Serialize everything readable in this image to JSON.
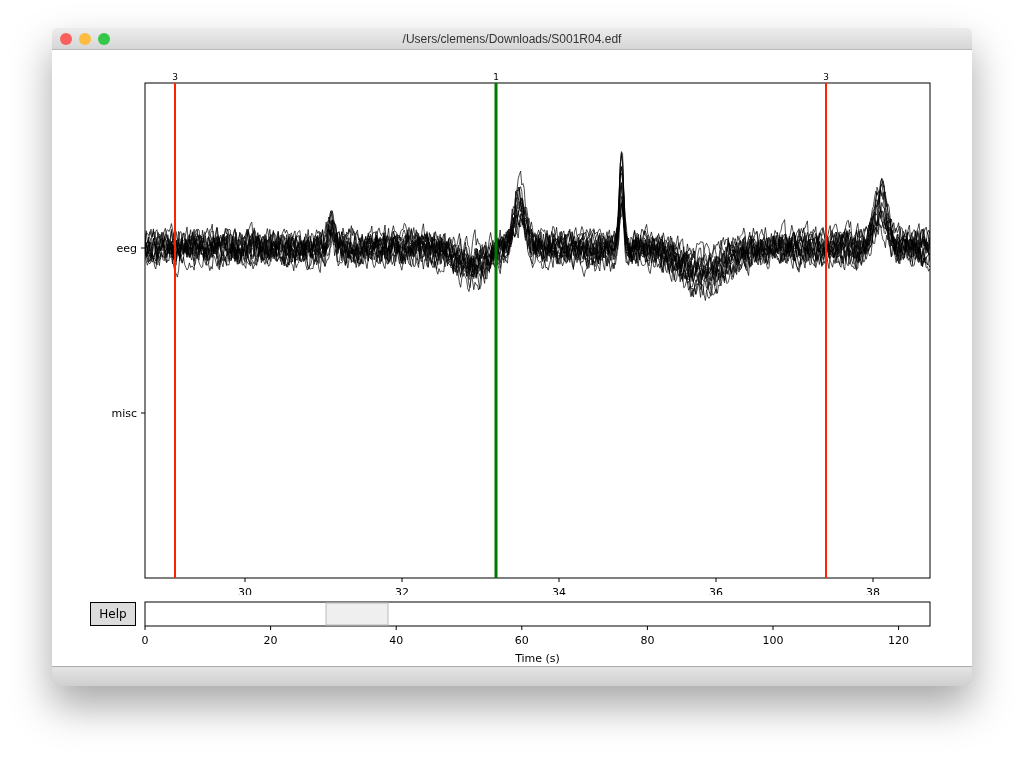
{
  "window": {
    "title": "/Users/clemens/Downloads/S001R04.edf"
  },
  "plot": {
    "channels": [
      "eeg",
      "misc"
    ],
    "x_tick_labels": [
      "30",
      "32",
      "34",
      "36",
      "38"
    ],
    "events": [
      {
        "label": "3",
        "color": "#ff2200"
      },
      {
        "label": "1",
        "color": "#007700"
      },
      {
        "label": "3",
        "color": "#ff2200"
      }
    ]
  },
  "help_button": {
    "label": "Help"
  },
  "scrollbar": {
    "x_tick_labels": [
      "0",
      "20",
      "40",
      "60",
      "80",
      "100",
      "120"
    ],
    "x_axis_title": "Time (s)"
  }
}
